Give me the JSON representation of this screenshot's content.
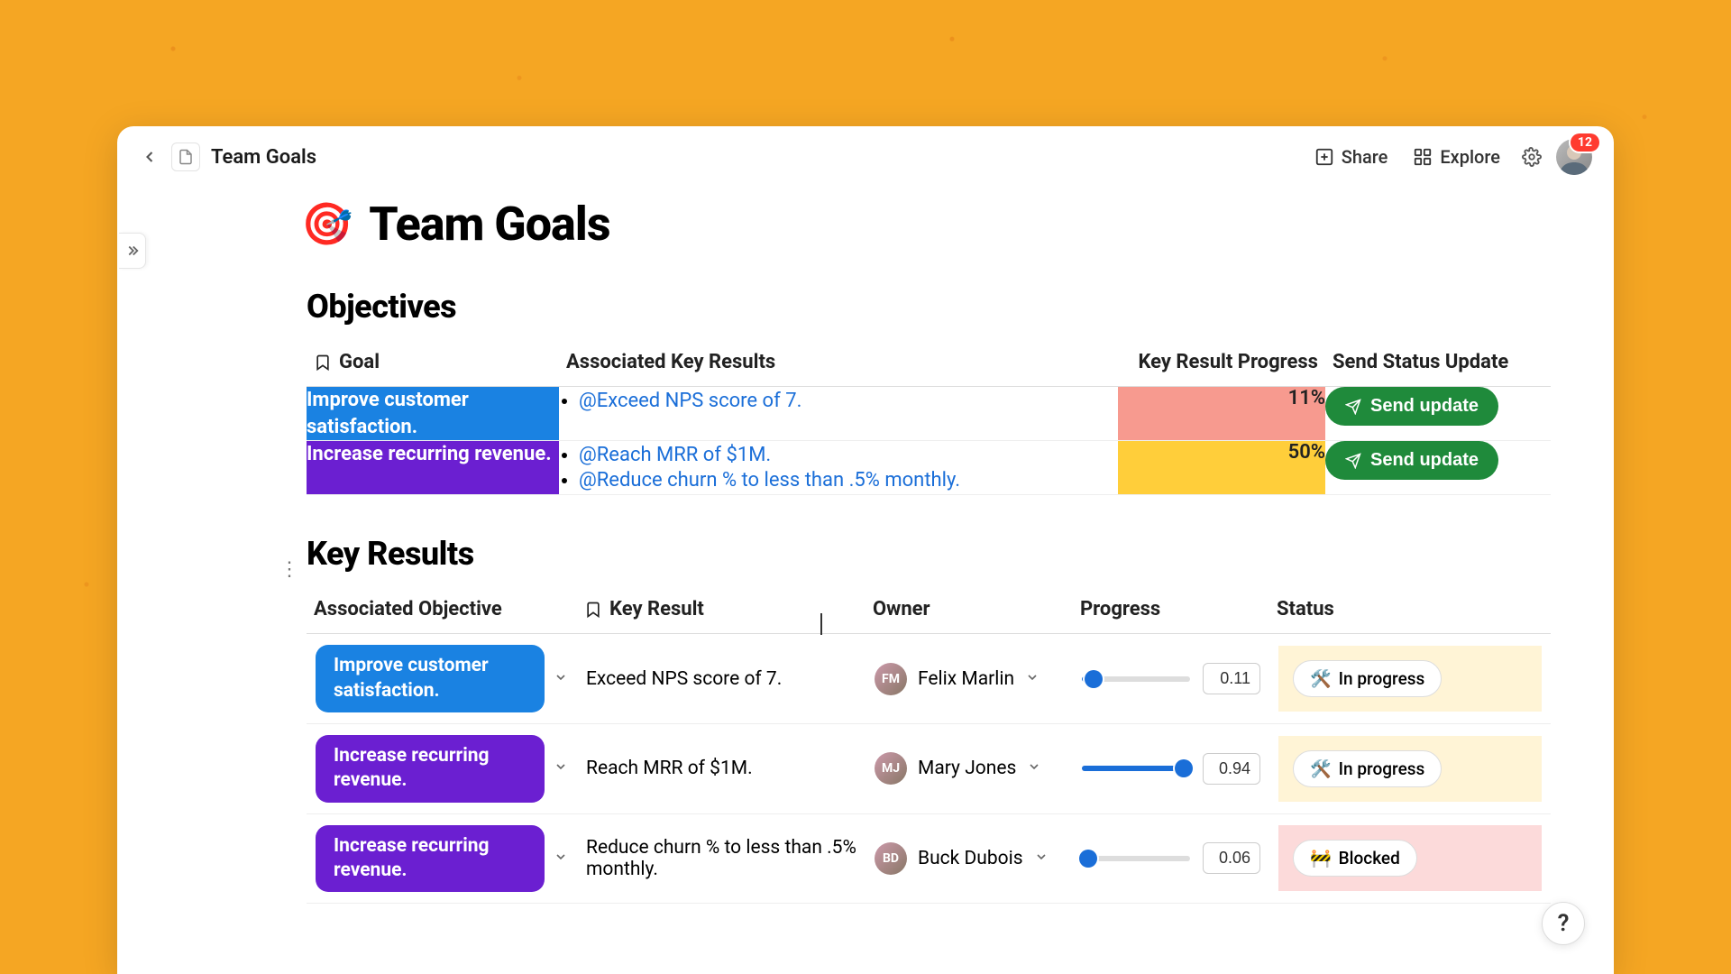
{
  "breadcrumb": "Team Goals",
  "page_title": "Team Goals",
  "page_emoji": "🎯",
  "topbar": {
    "share": "Share",
    "explore": "Explore",
    "notification_count": "12"
  },
  "sections": {
    "objectives_heading": "Objectives",
    "keyresults_heading": "Key Results"
  },
  "objectives": {
    "columns": {
      "goal": "Goal",
      "assoc": "Associated Key Results",
      "progress": "Key Result Progress",
      "send": "Send Status Update"
    },
    "rows": [
      {
        "goal": "Improve customer satisfaction.",
        "goal_color": "blue",
        "key_results": [
          "@Exceed NPS score of 7."
        ],
        "progress": "11%",
        "progress_color": "red",
        "send_label": "Send update"
      },
      {
        "goal": "Increase recurring revenue.",
        "goal_color": "purple",
        "key_results": [
          "@Reach MRR of $1M.",
          "@Reduce churn % to less than .5% monthly."
        ],
        "progress": "50%",
        "progress_color": "yellow",
        "send_label": "Send update"
      }
    ]
  },
  "key_results": {
    "columns": {
      "assoc_obj": "Associated Objective",
      "kr": "Key Result",
      "owner": "Owner",
      "progress": "Progress",
      "status": "Status"
    },
    "rows": [
      {
        "objective": "Improve customer satisfaction.",
        "obj_color": "blue",
        "kr": "Exceed NPS score of 7.",
        "owner": "Felix Marlin",
        "progress_value": "0.11",
        "progress_frac": 0.11,
        "status_icon": "🛠️",
        "status": "In progress",
        "status_bg": "yellow"
      },
      {
        "objective": "Increase recurring revenue.",
        "obj_color": "purple",
        "kr": "Reach MRR of $1M.",
        "owner": "Mary Jones",
        "progress_value": "0.94",
        "progress_frac": 0.94,
        "status_icon": "🛠️",
        "status": "In progress",
        "status_bg": "yellow"
      },
      {
        "objective": "Increase recurring revenue.",
        "obj_color": "purple",
        "kr": "Reduce churn % to less than .5% monthly.",
        "owner": "Buck Dubois",
        "progress_value": "0.06",
        "progress_frac": 0.06,
        "status_icon": "🚧",
        "status": "Blocked",
        "status_bg": "red"
      }
    ]
  },
  "help_label": "?"
}
